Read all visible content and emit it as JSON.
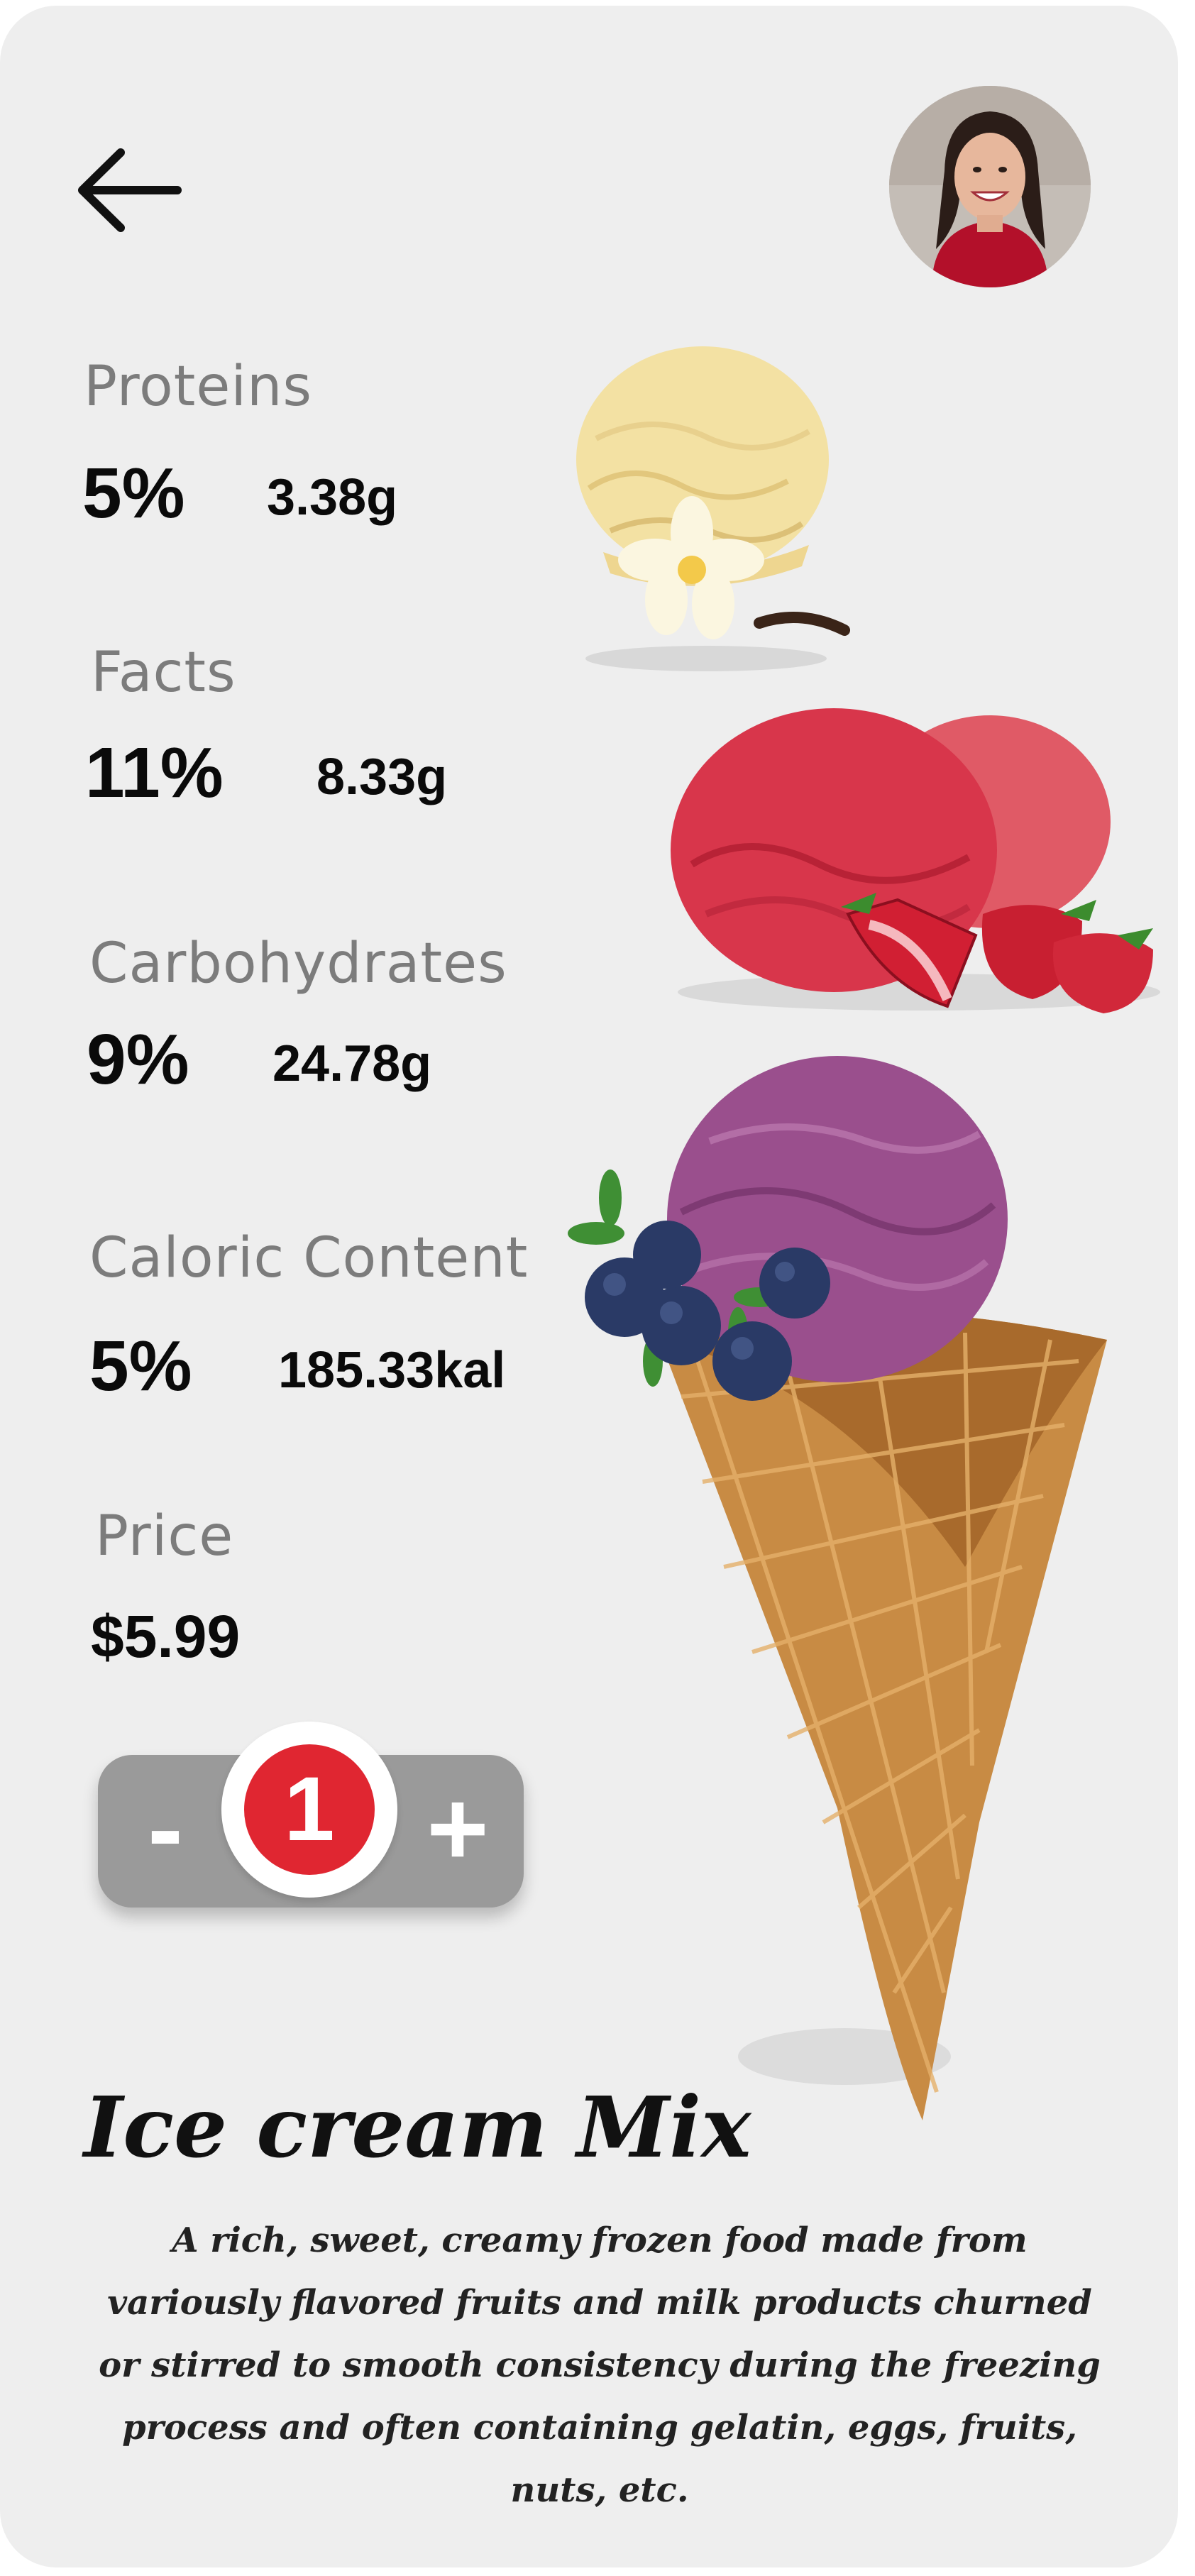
{
  "header": {
    "back_icon": "arrow-left-icon",
    "avatar_alt": "user avatar"
  },
  "nutrition": {
    "proteins": {
      "label": "Proteins",
      "percent": "5%",
      "amount": "3.38g"
    },
    "facts": {
      "label": "Facts",
      "percent": "11%",
      "amount": "8.33g"
    },
    "carbohydrates": {
      "label": "Carbohydrates",
      "percent": "9%",
      "amount": "24.78g"
    },
    "calories": {
      "label": "Caloric Content",
      "percent": "5%",
      "amount": "185.33kal"
    }
  },
  "price": {
    "label": "Price",
    "value": "$5.99"
  },
  "quantity": {
    "minus": "-",
    "plus": "+",
    "value": "1"
  },
  "product": {
    "title": "Ice cream Mix",
    "description": "A rich, sweet, creamy frozen food made from variously flavored fruits and milk products churned or stirred to smooth consistency during the freezing process and often containing gelatin, eggs, fruits, nuts, etc."
  },
  "colors": {
    "card_bg": "#eeeeee",
    "label_gray": "#7c7c7c",
    "stepper_gray": "#9a9a9a",
    "quantity_red": "#e02631",
    "vanilla": "#f3e1a3",
    "strawberry": "#d8364b",
    "blueberry": "#9a4f8d",
    "cone": "#c88b44"
  }
}
